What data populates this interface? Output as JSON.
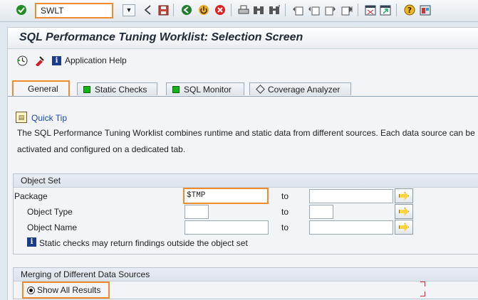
{
  "toolbar": {
    "command_value": "SWLT",
    "icons": [
      "enter-icon",
      "back-icon",
      "save-icon",
      "exit-icon",
      "logoff-icon",
      "cancel-icon",
      "print-icon",
      "find-icon",
      "find-next-icon",
      "first-page-icon",
      "previous-page-icon",
      "next-page-icon",
      "last-page-icon",
      "new-session-icon",
      "shortcut-icon",
      "help-icon",
      "customize-layout-icon"
    ]
  },
  "page": {
    "title": "SQL Performance Tuning Worklist: Selection Screen",
    "app_help": "Application Help"
  },
  "tabs": [
    {
      "label": "General",
      "active": true
    },
    {
      "label": "Static Checks",
      "active": false
    },
    {
      "label": "SQL Monitor",
      "active": false
    },
    {
      "label": "Coverage Analyzer",
      "active": false
    }
  ],
  "quick_tip": {
    "link": "Quick Tip",
    "text": "The SQL Performance Tuning Worklist combines runtime and static data from different sources. Each data source can be activated and configured on a dedicated tab."
  },
  "object_set": {
    "title": "Object Set",
    "rows": [
      {
        "label": "Package",
        "from": "$TMP",
        "to": "",
        "to_label": "to"
      },
      {
        "label": "Object Type",
        "from": "",
        "to": "",
        "to_label": "to"
      },
      {
        "label": "Object Name",
        "from": "",
        "to": "",
        "to_label": "to"
      }
    ],
    "info_text": "Static checks may return findings outside the object set"
  },
  "merging": {
    "title": "Merging of Different Data Sources",
    "option": "Show All Results"
  },
  "colors": {
    "highlight": "#f08a2c",
    "link": "#1848b8",
    "active_indicator": "#16b316"
  }
}
